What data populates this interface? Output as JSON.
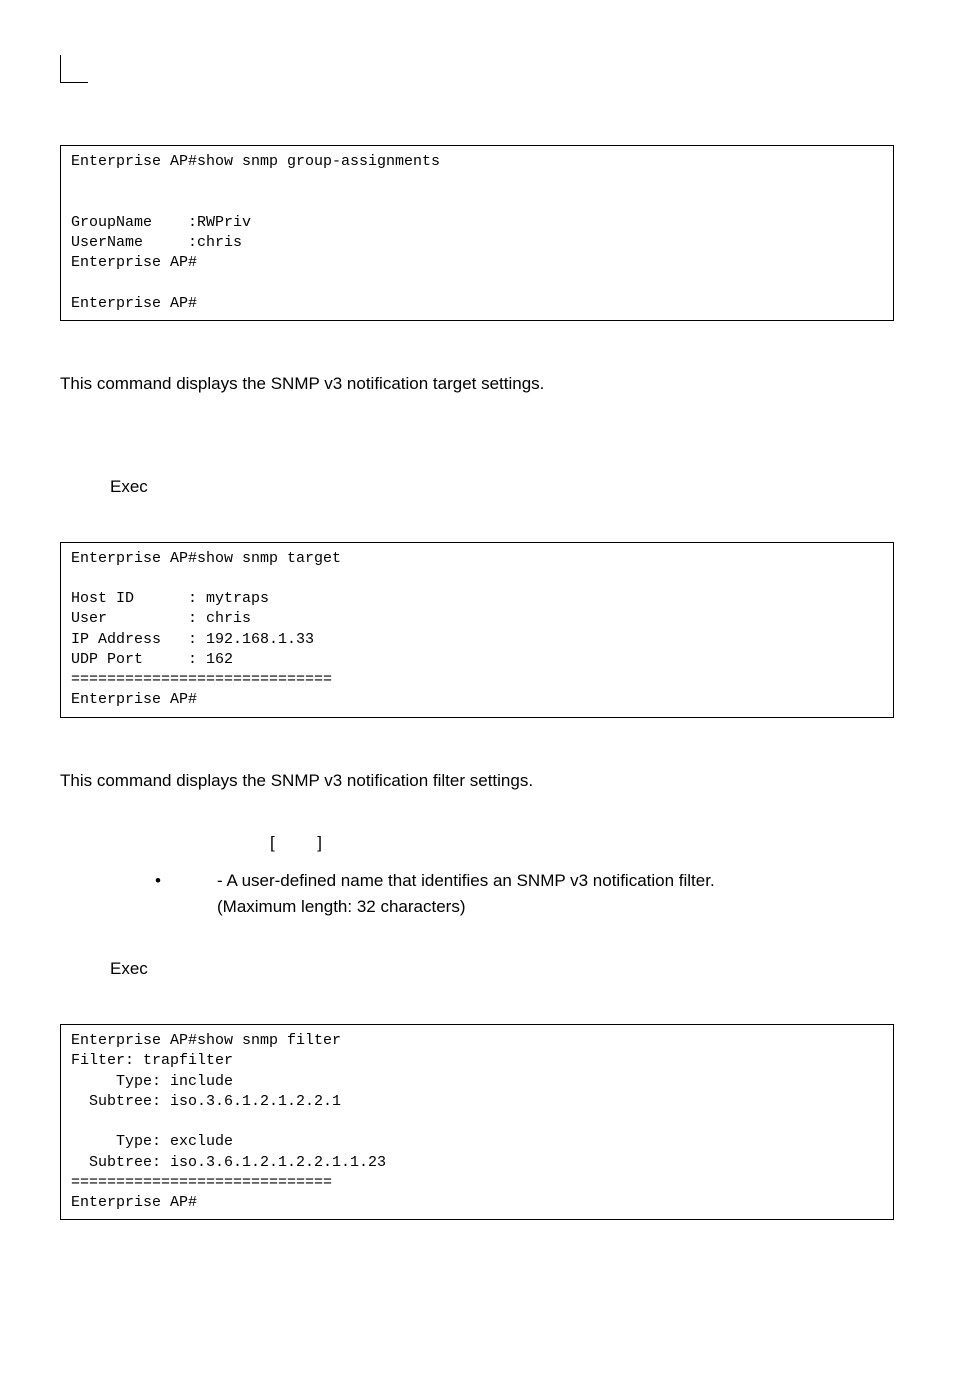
{
  "code1": "Enterprise AP#show snmp group-assignments\n\n\nGroupName    :RWPriv\nUserName     :chris\nEnterprise AP#\n\nEnterprise AP#",
  "desc_target": "This command displays the SNMP v3 notification target settings.",
  "mode_exec1": "Exec",
  "code2": "Enterprise AP#show snmp target\n\nHost ID      : mytraps\nUser         : chris\nIP Address   : 192.168.1.33\nUDP Port     : 162\n=============================\nEnterprise AP#",
  "desc_filter": "This command displays the SNMP v3 notification filter settings.",
  "syntax_brackets": "[         ]",
  "bullet_text": " - A user-defined name that identifies an SNMP v3 notification filter.",
  "bullet_sub": "(Maximum length: 32 characters)",
  "mode_exec2": "Exec",
  "code3": "Enterprise AP#show snmp filter\nFilter: trapfilter\n     Type: include\n  Subtree: iso.3.6.1.2.1.2.2.1\n\n     Type: exclude\n  Subtree: iso.3.6.1.2.1.2.2.1.1.23\n=============================\nEnterprise AP#"
}
